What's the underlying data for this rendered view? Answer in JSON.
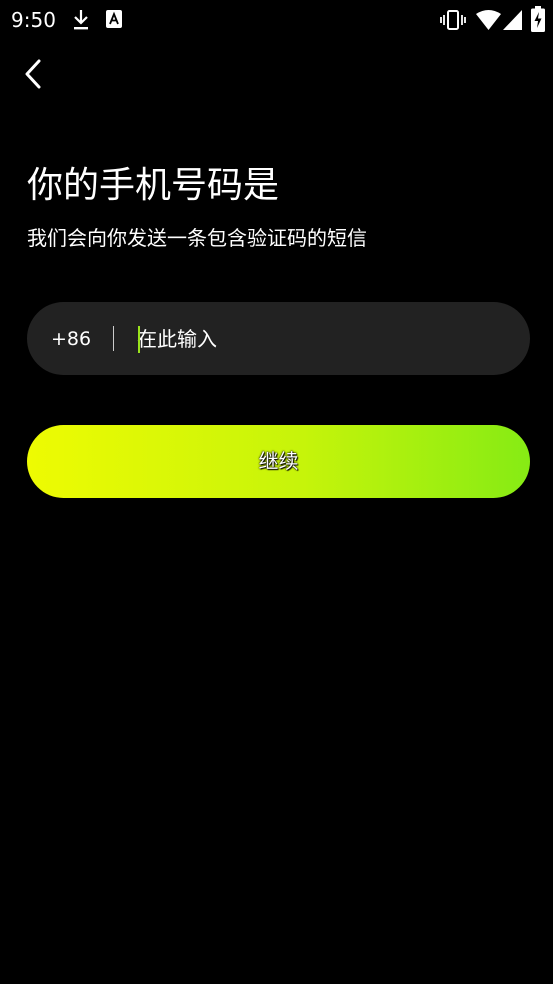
{
  "status_bar": {
    "time": "9:50",
    "icons": [
      "download-icon",
      "text-notification-icon",
      "vibrate-icon",
      "wifi-icon",
      "signal-icon",
      "battery-charging-icon"
    ]
  },
  "navigation": {
    "back_icon": "chevron-left-icon"
  },
  "header": {
    "title": "你的手机号码是",
    "subtitle": "我们会向你发送一条包含验证码的短信"
  },
  "phone_input": {
    "country_code": "+86",
    "placeholder": "在此输入",
    "value": ""
  },
  "continue_button": {
    "label": "继续"
  },
  "colors": {
    "background": "#000000",
    "field_background": "#222222",
    "gradient_start": "#eefb02",
    "gradient_end": "#86eb14",
    "cursor": "#9ae31c"
  }
}
